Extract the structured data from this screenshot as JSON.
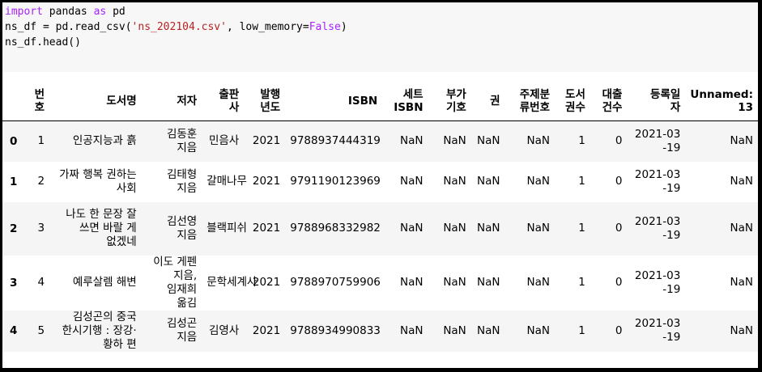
{
  "code": {
    "line1": {
      "kw1": "import",
      "t1": " pandas ",
      "kw2": "as",
      "t2": " pd"
    },
    "line2": {
      "t1": "ns_df = pd.read_csv(",
      "str": "'ns_202104.csv'",
      "t2": ", low_memory=",
      "kw": "False",
      "t3": ")"
    },
    "line3": {
      "t1": "ns_df.head()"
    }
  },
  "table": {
    "columns": [
      "번\n호",
      "도서명",
      "저자",
      "출판\n사",
      "발행\n년도",
      "ISBN",
      "세트\nISBN",
      "부가\n기호",
      "권",
      "주제분\n류번호",
      "도서\n권수",
      "대출\n건수",
      "등록일\n자",
      "Unnamed:\n13"
    ],
    "rows": [
      {
        "index": "0",
        "cells": [
          "1",
          "인공지능과 흙",
          "김동훈 지음",
          "민음사",
          "2021",
          "9788937444319",
          "NaN",
          "NaN",
          "NaN",
          "NaN",
          "1",
          "0",
          "2021-03-19",
          "NaN"
        ]
      },
      {
        "index": "1",
        "cells": [
          "2",
          "가짜 행복 권하는 사회",
          "김태형 지음",
          "갈매나무",
          "2021",
          "9791190123969",
          "NaN",
          "NaN",
          "NaN",
          "NaN",
          "1",
          "0",
          "2021-03-19",
          "NaN"
        ]
      },
      {
        "index": "2",
        "cells": [
          "3",
          "나도 한 문장 잘 쓰면 바랄 게 없겠네",
          "김선영 지음",
          "블랙피쉬",
          "2021",
          "9788968332982",
          "NaN",
          "NaN",
          "NaN",
          "NaN",
          "1",
          "0",
          "2021-03-19",
          "NaN"
        ]
      },
      {
        "index": "3",
        "cells": [
          "4",
          "예루살렘 해변",
          "이도 게펜 지음, 임재희 옮김",
          "문학세계사",
          "2021",
          "9788970759906",
          "NaN",
          "NaN",
          "NaN",
          "NaN",
          "1",
          "0",
          "2021-03-19",
          "NaN"
        ]
      },
      {
        "index": "4",
        "cells": [
          "5",
          "김성곤의 중국 한시기행 : 장강·황하 편",
          "김성곤 지음",
          "김영사",
          "2021",
          "9788934990833",
          "NaN",
          "NaN",
          "NaN",
          "NaN",
          "1",
          "0",
          "2021-03-19",
          "NaN"
        ]
      }
    ]
  }
}
